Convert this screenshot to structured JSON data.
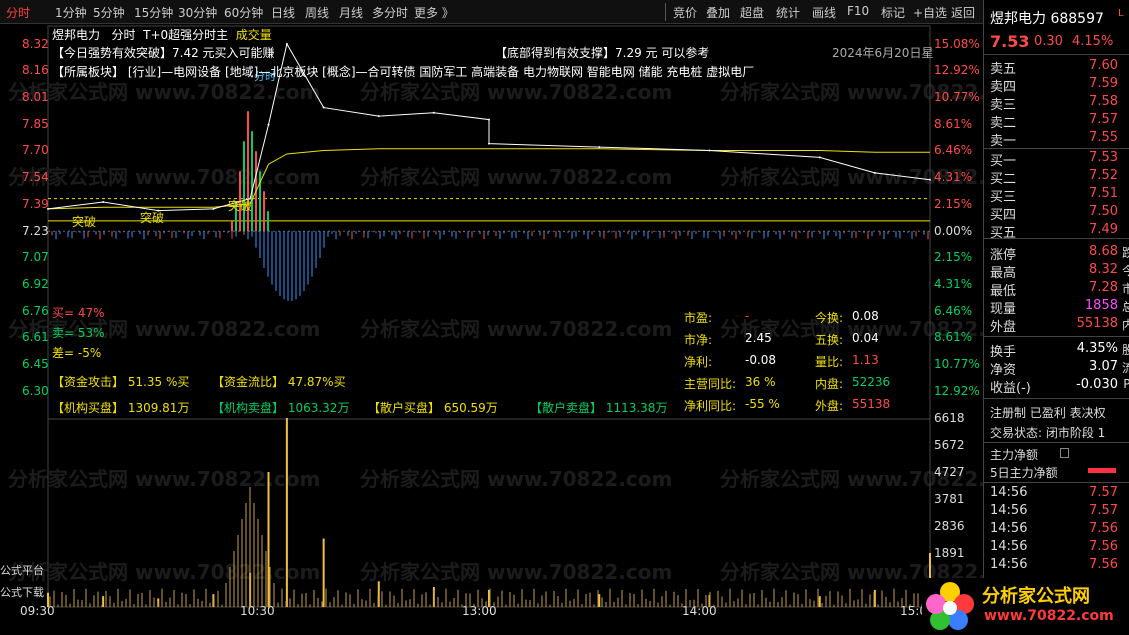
{
  "toolbar": {
    "left": [
      "分时",
      "1分钟",
      "5分钟",
      "15分钟",
      "30分钟",
      "60分钟",
      "日线",
      "周线",
      "月线",
      "多分时",
      "更多 》"
    ],
    "right": [
      "竞价",
      "叠加",
      "超盘",
      "统计",
      "画线",
      "F10",
      "标记",
      "+自选",
      "返回"
    ]
  },
  "header": {
    "name": "煜邦电力",
    "mode": "分时",
    "indicator": "T+0超强分时主",
    "volume_label": "成交量",
    "date": "2024年6月20日星"
  },
  "signals": {
    "top_left": "【今日强势有效突破】7.42 元买入可能赚",
    "top_right": "【底部得到有效支撑】7.29 元 可以参考",
    "sectors": "【所属板块】 [行业]—电网设备 [地域]—北京板块 [概念]—合可转债 国防军工 高端装备 电力物联网 智能电网 储能 充电桩 虚拟电厂"
  },
  "price_axis_left": [
    "8.32",
    "8.16",
    "8.01",
    "7.85",
    "7.70",
    "7.54",
    "7.39",
    "7.23",
    "7.07",
    "6.92",
    "6.76",
    "6.61",
    "6.45",
    "6.30"
  ],
  "price_axis_right": [
    "15.08%",
    "12.92%",
    "10.77%",
    "8.61%",
    "6.46%",
    "4.31%",
    "2.15%",
    "0.00%",
    "2.15%",
    "4.31%",
    "6.46%",
    "8.61%",
    "10.77%",
    "12.92%"
  ],
  "volume_axis": [
    "6618",
    "5672",
    "4727",
    "3781",
    "2836",
    "1891"
  ],
  "time_axis": [
    "09:30",
    "10:30",
    "13:00",
    "14:00",
    "15:0"
  ],
  "chart_labels": {
    "breakout": "突破",
    "pinned": "分时"
  },
  "buy_sell": {
    "buy": "买= 47%",
    "sell": "卖= 53%",
    "diff": "差= -5%"
  },
  "capital": {
    "attack": "【资金攻击】 51.35 %买",
    "flow": "【资金流比】 47.87%买",
    "inst_buy": "【机构买盘】 1309.81万",
    "inst_sell": "【机构卖盘】 1063.32万",
    "retail_buy": "【散户买盘】 650.59万",
    "retail_sell": "【散户卖盘】 1113.38万"
  },
  "stats": [
    {
      "k": "市盈:",
      "v": "-",
      "k2": "今换:",
      "v2": "0.08"
    },
    {
      "k": "市净:",
      "v": "2.45",
      "k2": "五换:",
      "v2": "0.04"
    },
    {
      "k": "净利:",
      "v": "-0.08",
      "k2": "量比:",
      "v2": "1.13"
    },
    {
      "k": "主营同比:",
      "v": "36 %",
      "k2": "内盘:",
      "v2": "52236"
    },
    {
      "k": "净利同比:",
      "v": "-55 %",
      "k2": "外盘:",
      "v2": "55138"
    }
  ],
  "left_edge": [
    "公式平台",
    "公式下载"
  ],
  "watermark": "分析家公式网 www.70822.com",
  "side": {
    "name": "煜邦电力 688597",
    "tag": "L",
    "price": "7.53",
    "change": "0.30",
    "pct": "4.15%",
    "asks": [
      {
        "k": "卖五",
        "v": "7.60"
      },
      {
        "k": "卖四",
        "v": "7.59"
      },
      {
        "k": "卖三",
        "v": "7.58"
      },
      {
        "k": "卖二",
        "v": "7.57"
      },
      {
        "k": "卖一",
        "v": "7.55"
      }
    ],
    "bids": [
      {
        "k": "买一",
        "v": "7.53"
      },
      {
        "k": "买二",
        "v": "7.52"
      },
      {
        "k": "买三",
        "v": "7.51"
      },
      {
        "k": "买四",
        "v": "7.50"
      },
      {
        "k": "买五",
        "v": "7.49"
      }
    ],
    "info": [
      {
        "k": "涨停",
        "v": "8.68",
        "x": "跌"
      },
      {
        "k": "最高",
        "v": "8.32",
        "x": "今"
      },
      {
        "k": "最低",
        "v": "7.28",
        "x": "市"
      },
      {
        "k": "现量",
        "v": "1858",
        "x": "总"
      },
      {
        "k": "外盘",
        "v": "55138",
        "x": "内"
      }
    ],
    "info2": [
      {
        "k": "换手",
        "v": "4.35%",
        "x": "股"
      },
      {
        "k": "净资",
        "v": "3.07",
        "x": "流"
      },
      {
        "k": "收益(-)",
        "v": "-0.030",
        "x": "PI"
      }
    ],
    "reg": "注册制 已盈利 表决权",
    "trade_state": "交易状态: 闭市阶段 1",
    "main_net": "主力净额",
    "main_net5": "5日主力净额",
    "ticks": [
      {
        "t": "14:56",
        "p": "7.57"
      },
      {
        "t": "14:56",
        "p": "7.57"
      },
      {
        "t": "14:56",
        "p": "7.56"
      },
      {
        "t": "14:56",
        "p": "7.56"
      },
      {
        "t": "14:56",
        "p": "7.56"
      }
    ],
    "logo": "分析家公式网",
    "logo_url": "www.70822.com"
  },
  "chart_data": {
    "type": "line",
    "prev_close": 7.23,
    "ylim": [
      6.3,
      8.32
    ],
    "price_x": [
      "09:30",
      "09:45",
      "10:00",
      "10:15",
      "10:25",
      "10:30",
      "10:35",
      "10:45",
      "11:00",
      "11:15",
      "11:30",
      "13:00",
      "13:30",
      "14:00",
      "14:30",
      "14:45",
      "15:00"
    ],
    "price": [
      7.36,
      7.4,
      7.35,
      7.36,
      7.42,
      7.85,
      8.32,
      7.95,
      7.9,
      7.92,
      7.88,
      7.74,
      7.72,
      7.7,
      7.66,
      7.57,
      7.53
    ],
    "avg": [
      7.36,
      7.37,
      7.37,
      7.37,
      7.39,
      7.62,
      7.68,
      7.7,
      7.71,
      7.71,
      7.71,
      7.71,
      7.71,
      7.7,
      7.7,
      7.69,
      7.69
    ],
    "volume_ylim": [
      0,
      6618
    ],
    "volume": [
      500,
      380,
      300,
      450,
      1200,
      4727,
      6618,
      2400,
      900,
      700,
      600,
      500,
      450,
      420,
      380,
      600,
      1891
    ]
  }
}
